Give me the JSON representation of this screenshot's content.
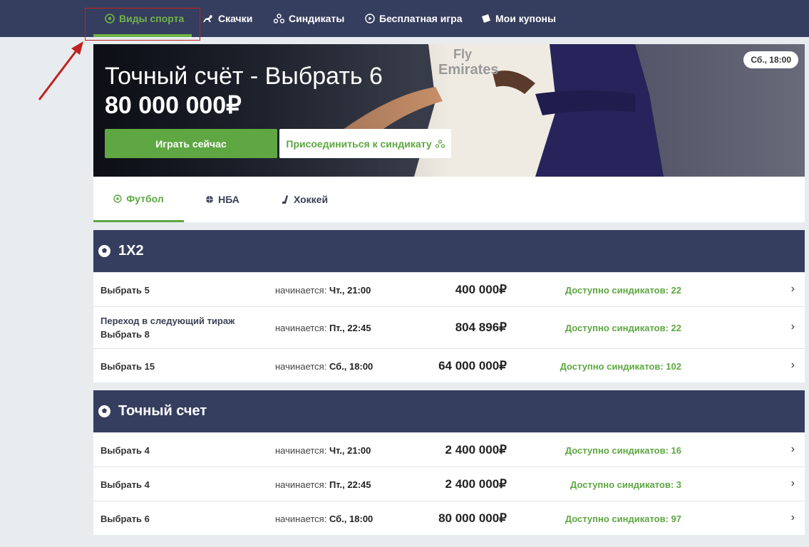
{
  "nav": {
    "items": [
      {
        "label": "Виды спорта",
        "icon": "soccer-ball-icon",
        "active": true
      },
      {
        "label": "Скачки",
        "icon": "horse-icon"
      },
      {
        "label": "Синдикаты",
        "icon": "syndicate-icon"
      },
      {
        "label": "Бесплатная игра",
        "icon": "play-circle-icon"
      },
      {
        "label": "Мои купоны",
        "icon": "coupon-icon"
      }
    ]
  },
  "banner": {
    "title": "Точный счёт - Выбрать 6",
    "amount": "80 000 000₽",
    "play_label": "Играть сейчас",
    "join_label": "Присоединиться к синдикату",
    "date": "Сб., 18:00",
    "jersey_text_1": "Fly",
    "jersey_text_2": "Emirates"
  },
  "sport_tabs": [
    {
      "label": "Футбол",
      "icon": "soccer-ball-icon",
      "active": true
    },
    {
      "label": "НБА",
      "icon": "basketball-icon"
    },
    {
      "label": "Хоккей",
      "icon": "hockey-stick-icon"
    }
  ],
  "sections": [
    {
      "title": "1X2",
      "rows": [
        {
          "name": "Выбрать 5",
          "sub": "",
          "starts_label": "начинается:",
          "starts": "Чт., 21:00",
          "prize": "400 000₽",
          "synd": "Доступно синдикатов: 22"
        },
        {
          "name": "Выбрать 8",
          "sub": "Переход в следующий тираж",
          "starts_label": "начинается:",
          "starts": "Пт., 22:45",
          "prize": "804 896₽",
          "synd": "Доступно синдикатов: 22"
        },
        {
          "name": "Выбрать 15",
          "sub": "",
          "starts_label": "начинается:",
          "starts": "Сб., 18:00",
          "prize": "64 000 000₽",
          "synd": "Доступно синдикатов: 102"
        }
      ]
    },
    {
      "title": "Точный счет",
      "rows": [
        {
          "name": "Выбрать 4",
          "sub": "",
          "starts_label": "начинается:",
          "starts": "Чт., 21:00",
          "prize": "2 400 000₽",
          "synd": "Доступно синдикатов: 16"
        },
        {
          "name": "Выбрать 4",
          "sub": "",
          "starts_label": "начинается:",
          "starts": "Пт., 22:45",
          "prize": "2 400 000₽",
          "synd": "Доступно синдикатов: 3"
        },
        {
          "name": "Выбрать 6",
          "sub": "",
          "starts_label": "начинается:",
          "starts": "Сб., 18:00",
          "prize": "80 000 000₽",
          "synd": "Доступно синдикатов: 97"
        }
      ]
    }
  ],
  "chevron": "›",
  "colors": {
    "nav_bg": "#363e5f",
    "accent": "#5ea742",
    "annotation": "#c0221f"
  }
}
